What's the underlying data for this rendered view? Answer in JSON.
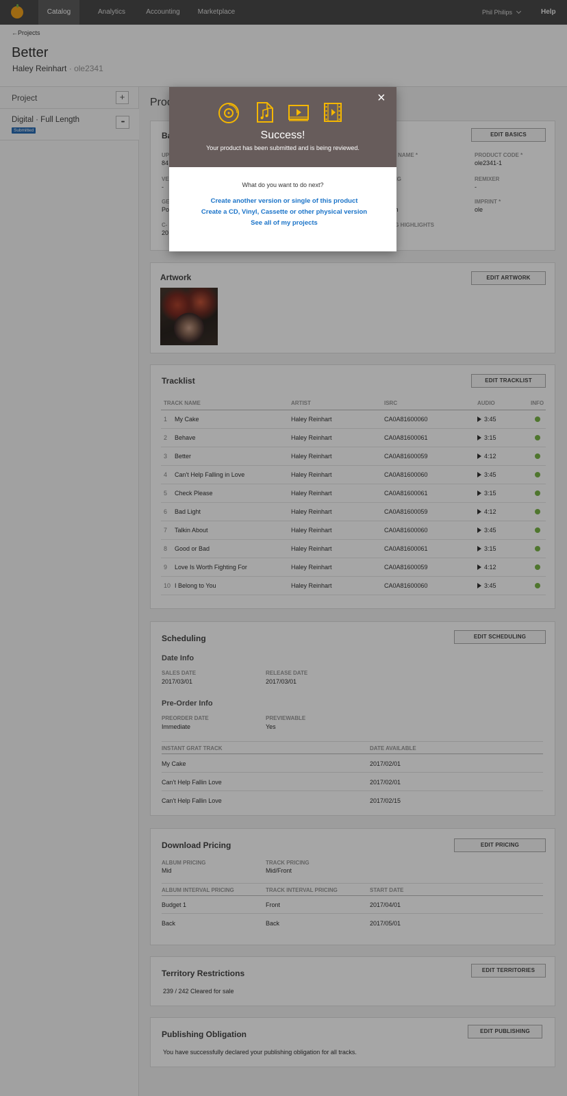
{
  "nav": {
    "items": [
      "Catalog",
      "Analytics",
      "Accounting",
      "Marketplace"
    ],
    "user": "Phil Philips",
    "help": "Help"
  },
  "header": {
    "back": "Projects",
    "title": "Better",
    "artist": "Haley Reinhart",
    "separator": "·",
    "project_code": "ole2341"
  },
  "sidebar": {
    "heading": "Project",
    "add": "+",
    "item_name": "Digital · Full Length",
    "item_status": "Submitted",
    "more": "•••"
  },
  "main": {
    "title_partial": "Proc"
  },
  "basics": {
    "title_partial": "Ba",
    "edit": "EDIT BASICS",
    "fields": [
      {
        "label": "UP",
        "value": "84"
      },
      {
        "label": "VE",
        "value": "-"
      },
      {
        "label": "GE",
        "value": "Po"
      },
      {
        "label": "C-",
        "value": "20"
      },
      {
        "label": "T NAME *",
        "value": ""
      },
      {
        "label": "NG",
        "value": ""
      },
      {
        "label": "",
        "value": "th"
      },
      {
        "label": "IG HIGHLIGHTS",
        "value": ""
      },
      {
        "label": "PRODUCT CODE *",
        "value": "ole2341-1"
      },
      {
        "label": "REMIXER",
        "value": "-"
      },
      {
        "label": "IMPRINT *",
        "value": "ole"
      }
    ]
  },
  "artwork": {
    "title": "Artwork",
    "edit": "EDIT ARTWORK"
  },
  "tracklist": {
    "title": "Tracklist",
    "edit": "EDIT TRACKLIST",
    "headers": [
      "TRACK NAME",
      "ARTIST",
      "ISRC",
      "AUDIO",
      "INFO"
    ],
    "rows": [
      {
        "num": "1",
        "name": "My Cake",
        "artist": "Haley Reinhart",
        "isrc": "CA0A81600060",
        "audio": "3:45"
      },
      {
        "num": "2",
        "name": "Behave",
        "artist": "Haley Reinhart",
        "isrc": "CA0A81600061",
        "audio": "3:15"
      },
      {
        "num": "3",
        "name": "Better",
        "artist": "Haley Reinhart",
        "isrc": "CA0A81600059",
        "audio": "4:12"
      },
      {
        "num": "4",
        "name": "Can't Help Falling in Love",
        "artist": "Haley Reinhart",
        "isrc": "CA0A81600060",
        "audio": "3:45"
      },
      {
        "num": "5",
        "name": "Check Please",
        "artist": "Haley Reinhart",
        "isrc": "CA0A81600061",
        "audio": "3:15"
      },
      {
        "num": "6",
        "name": "Bad Light",
        "artist": "Haley Reinhart",
        "isrc": "CA0A81600059",
        "audio": "4:12"
      },
      {
        "num": "7",
        "name": "Talkin About",
        "artist": "Haley Reinhart",
        "isrc": "CA0A81600060",
        "audio": "3:45"
      },
      {
        "num": "8",
        "name": "Good or Bad",
        "artist": "Haley Reinhart",
        "isrc": "CA0A81600061",
        "audio": "3:15"
      },
      {
        "num": "9",
        "name": "Love Is Worth Fighting For",
        "artist": "Haley Reinhart",
        "isrc": "CA0A81600059",
        "audio": "4:12"
      },
      {
        "num": "10",
        "name": "I Belong to You",
        "artist": "Haley Reinhart",
        "isrc": "CA0A81600060",
        "audio": "3:45"
      }
    ]
  },
  "scheduling": {
    "title": "Scheduling",
    "edit": "EDIT SCHEDULING",
    "date_info": "Date Info",
    "sales_date_label": "SALES DATE",
    "sales_date": "2017/03/01",
    "release_date_label": "RELEASE DATE",
    "release_date": "2017/03/01",
    "preorder_info": "Pre-Order Info",
    "preorder_date_label": "PREORDER DATE",
    "preorder_date": "Immediate",
    "previewable_label": "PREVIEWABLE",
    "previewable": "Yes",
    "grat_header": "INSTANT GRAT TRACK",
    "avail_header": "DATE AVAILABLE",
    "grat_rows": [
      {
        "track": "My Cake",
        "date": "2017/02/01"
      },
      {
        "track": "Can't Help Fallin Love",
        "date": "2017/02/01"
      },
      {
        "track": "Can't Help Fallin Love",
        "date": "2017/02/15"
      }
    ]
  },
  "pricing": {
    "title": "Download Pricing",
    "edit": "EDIT PRICING",
    "album_label": "ALBUM PRICING",
    "album": "Mid",
    "track_label": "TRACK PRICING",
    "track": "Mid/Front",
    "interval_headers": [
      "ALBUM INTERVAL PRICING",
      "TRACK INTERVAL PRICING",
      "START DATE"
    ],
    "interval_rows": [
      {
        "album": "Budget 1",
        "track": "Front",
        "start": "2017/04/01"
      },
      {
        "album": "Back",
        "track": "Back",
        "start": "2017/05/01"
      }
    ]
  },
  "territory": {
    "title": "Territory Restrictions",
    "edit": "EDIT TERRITORIES",
    "text": "239 / 242 Cleared for sale"
  },
  "publishing": {
    "title": "Publishing Obligation",
    "edit": "EDIT PUBLISHING",
    "text": "You have successfully declared your publishing obligation for all tracks."
  },
  "modal": {
    "close": "×",
    "title": "Success!",
    "subtitle": "Your product has been submitted and is being reviewed.",
    "question": "What do you want to do next?",
    "links": [
      "Create another version or single of this product",
      "Create a CD, Vinyl, Cassette or other physical version",
      "See all of my projects"
    ],
    "icons": [
      "disc-icon",
      "music-file-icon",
      "video-player-icon",
      "film-icon"
    ],
    "icon_color": "#f5b700"
  },
  "colors": {
    "topbar": "#4b4b4b",
    "link": "#1a73c8",
    "success": "#7ab648",
    "badge": "#2a6db5"
  }
}
